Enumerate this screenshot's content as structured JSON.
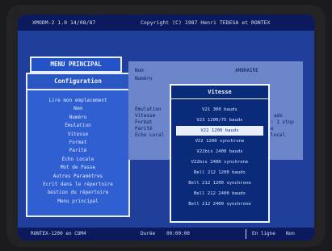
{
  "header": {
    "left": "XMODM-2 1.0 14/08/87",
    "right": "Copyright (C) 1987 Henri TEDESA et RONTEX"
  },
  "menu": {
    "title": "MENU PRINCIPAL",
    "panel_title": "Configuration",
    "items": [
      "Lire mon emplacement",
      "Nom",
      "Numéro",
      "Émulation",
      "Vitesse",
      "Format",
      "Parité",
      "Écho Locale",
      "Mot de Passe",
      "Autres Paramètres",
      "Ecrit dans le répertoire",
      "Gestion du répertoire",
      "Menu principal"
    ]
  },
  "info": {
    "nom_label": "Nom",
    "numero_label": "Numéro",
    "nom_value": "AMBRAIRE",
    "labels": [
      "Émulation",
      "Vitesse",
      "Format",
      "Parité",
      "Écho Local"
    ],
    "right_fragments": [
      "ads",
      ": 1 stop",
      "e",
      "local"
    ]
  },
  "popup": {
    "title": "Vitesse",
    "items": [
      "V21 300 bauds",
      "V23 1200/75 bauds",
      "V22 1200 bauds",
      "V22 1200 synchrone",
      "V22bis 2400 bauds",
      "V22bis 2400 synchrone",
      "Bell 212 1200 bauds",
      "Bell 212 1200 synchrone",
      "Bell 212 2400 bauds",
      "Bell 212 2400 synchrone"
    ],
    "selected_index": 2
  },
  "status": {
    "left": "RONTEX-1200 en COM4",
    "duree_label": "Durée",
    "duree_value": "00:00:00",
    "right": "En ligne",
    "right2": "Non"
  }
}
